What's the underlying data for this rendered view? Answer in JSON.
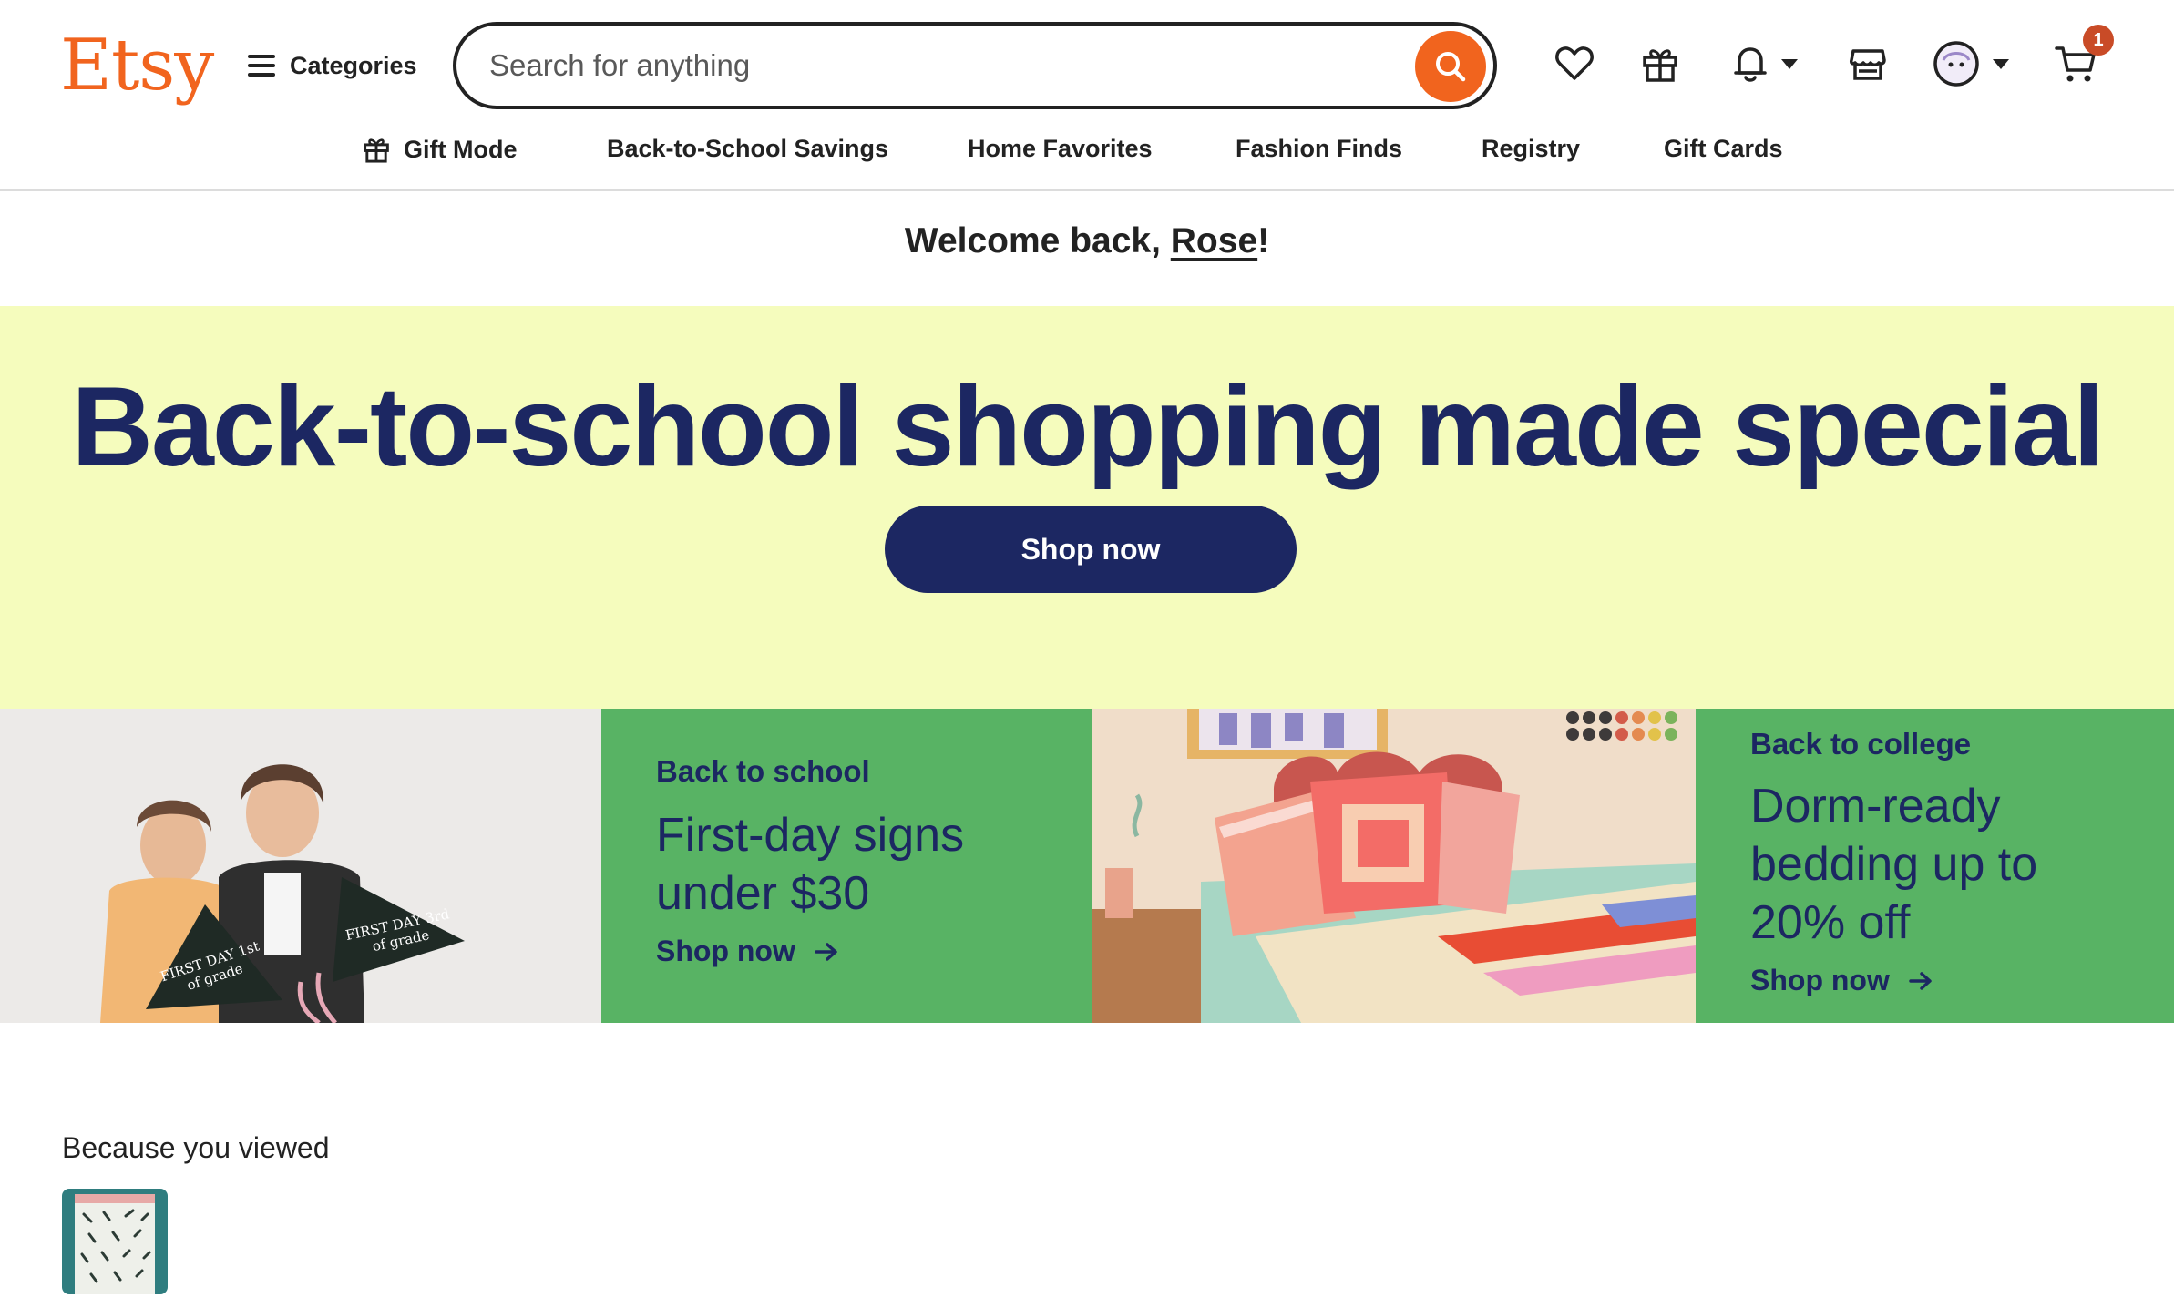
{
  "header": {
    "logo": "Etsy",
    "categories_label": "Categories",
    "search_placeholder": "Search for anything",
    "cart_count": "1",
    "icons": [
      "heart-icon",
      "gift-icon",
      "bell-icon",
      "shop-icon",
      "avatar",
      "cart-icon"
    ]
  },
  "nav": {
    "items": [
      {
        "label": "Gift Mode",
        "icon": "gift-icon"
      },
      {
        "label": "Back-to-School Savings"
      },
      {
        "label": "Home Favorites"
      },
      {
        "label": "Fashion Finds"
      },
      {
        "label": "Registry"
      },
      {
        "label": "Gift Cards"
      }
    ]
  },
  "welcome": {
    "prefix": "Welcome back, ",
    "name": "Rose",
    "suffix": "!"
  },
  "hero": {
    "title": "Back-to-school shopping made special",
    "button": "Shop now"
  },
  "promos": [
    {
      "eyebrow": "Back to school",
      "title": "First-day signs under $30",
      "link": "Shop now",
      "image_pennant_1": "FIRST DAY 1st of grade",
      "image_pennant_2": "FIRST DAY 3rd of grade"
    },
    {
      "eyebrow": "Back to college",
      "title": "Dorm-ready bedding up to 20% off",
      "link": "Shop now"
    }
  ],
  "because_viewed": {
    "title": "Because you viewed"
  },
  "colors": {
    "brand": "#f1641e",
    "navy": "#1c2762",
    "hero_bg": "#f5fcbd",
    "promo_green": "#58b364",
    "badge": "#c94b27"
  }
}
